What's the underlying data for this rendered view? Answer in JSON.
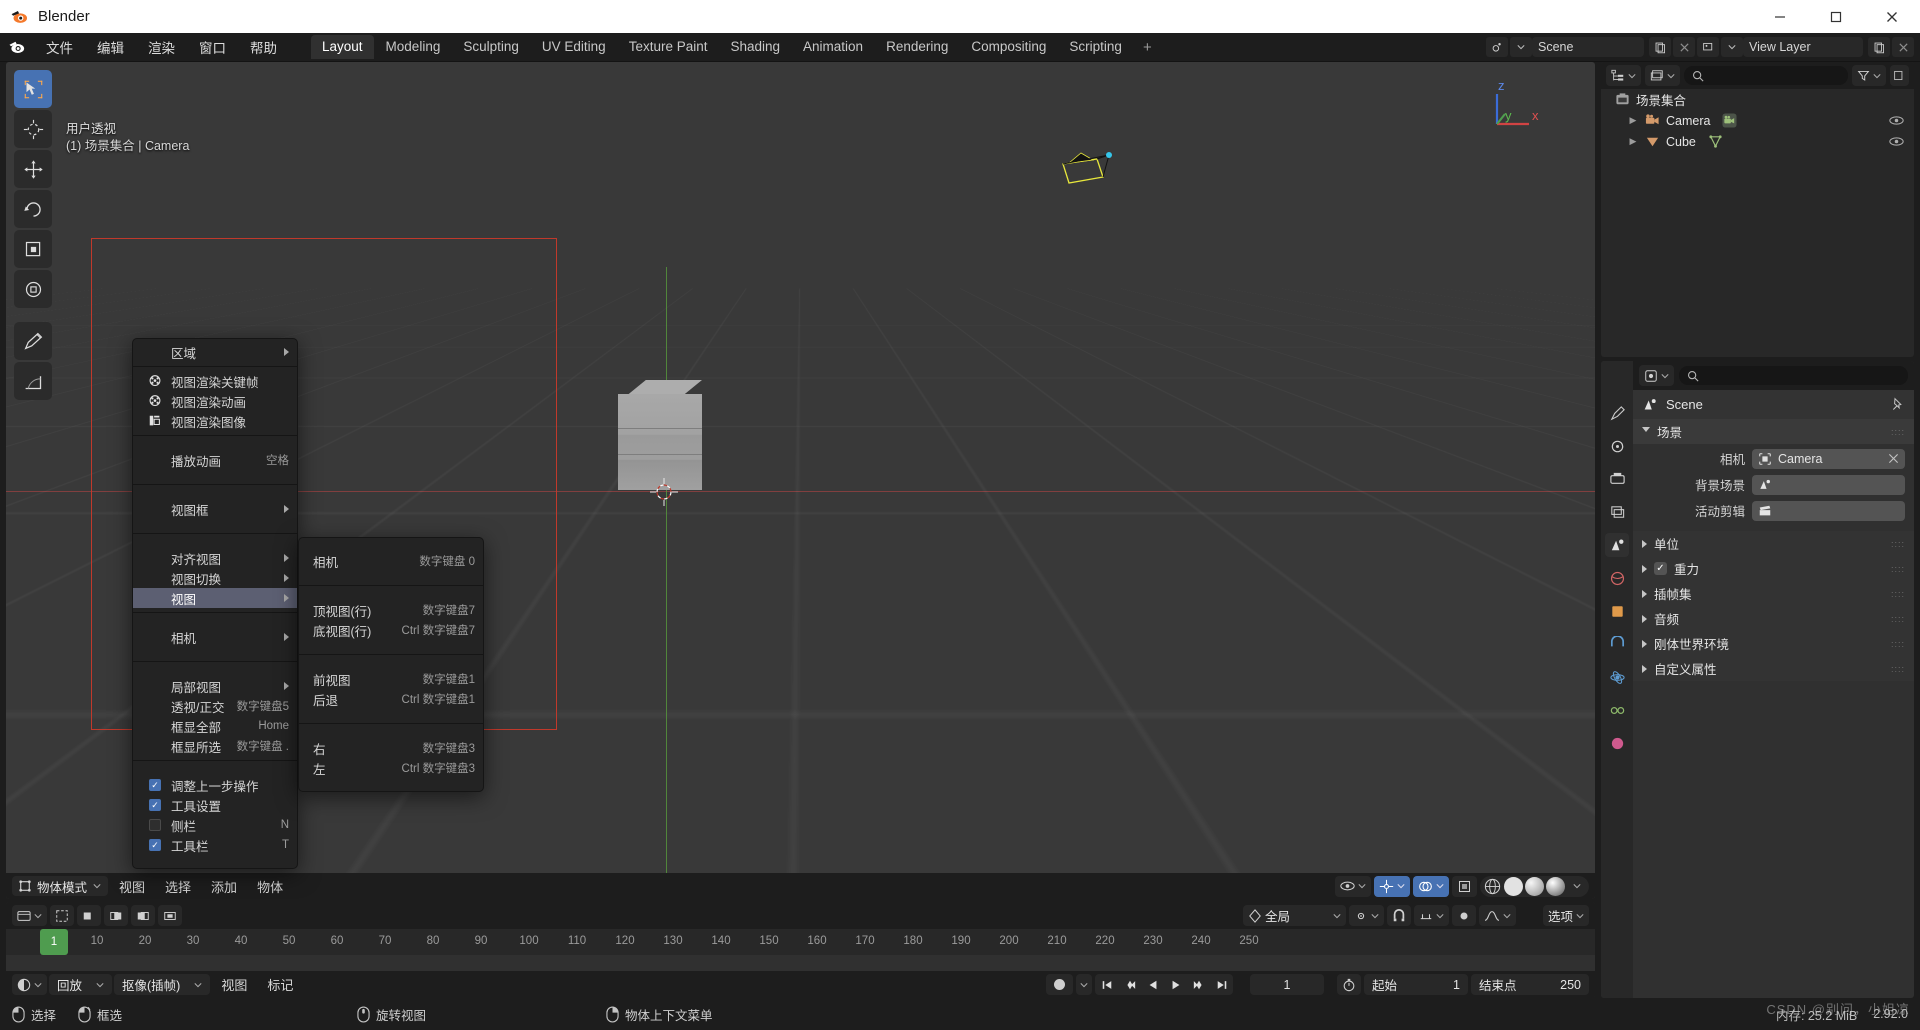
{
  "window": {
    "title": "Blender",
    "buttons": {
      "minimize": "─",
      "maximize": "☐",
      "close": "✕"
    }
  },
  "topbar": {
    "menus": [
      "文件",
      "编辑",
      "渲染",
      "窗口",
      "帮助"
    ],
    "workspaces": [
      "Layout",
      "Modeling",
      "Sculpting",
      "UV Editing",
      "Texture Paint",
      "Shading",
      "Animation",
      "Rendering",
      "Compositing",
      "Scripting"
    ],
    "add_workspace": "+",
    "scene_name": "Scene",
    "view_layer_name": "View Layer"
  },
  "viewport": {
    "overlay_line1": "用户透视",
    "overlay_line2": "(1) 场景集合 | Camera",
    "gizmo_axes": {
      "x": "x",
      "y": "y",
      "z": "z"
    },
    "footer": {
      "mode": "物体模式",
      "menus": [
        "视图",
        "选择",
        "添加",
        "物体"
      ]
    }
  },
  "toolbar": {
    "tools": [
      "tweak-select-tool",
      "cursor-tool",
      "move-tool",
      "rotate-tool",
      "scale-tool",
      "transform-tool",
      "annotate-tool",
      "measure-tool"
    ]
  },
  "context_menu": {
    "items": [
      {
        "type": "item",
        "label": "区域",
        "shortcut": "",
        "arrow": true,
        "icon": ""
      },
      {
        "type": "sep"
      },
      {
        "type": "item",
        "label": "视图渲染关键帧",
        "shortcut": "",
        "arrow": false,
        "icon": "film-icon"
      },
      {
        "type": "item",
        "label": "视图渲染动画",
        "shortcut": "",
        "arrow": false,
        "icon": "film-icon"
      },
      {
        "type": "item",
        "label": "视图渲染图像",
        "shortcut": "",
        "arrow": false,
        "icon": "render-image-icon"
      },
      {
        "type": "sep"
      },
      {
        "type": "item",
        "label": "播放动画",
        "shortcut": "空格",
        "arrow": false,
        "icon": ""
      },
      {
        "type": "sep"
      },
      {
        "type": "item",
        "label": "视图框",
        "shortcut": "",
        "arrow": true,
        "icon": ""
      },
      {
        "type": "sep"
      },
      {
        "type": "item",
        "label": "对齐视图",
        "shortcut": "",
        "arrow": true,
        "icon": ""
      },
      {
        "type": "item",
        "label": "视图切换",
        "shortcut": "",
        "arrow": true,
        "icon": ""
      },
      {
        "type": "item",
        "label": "视图",
        "shortcut": "",
        "arrow": true,
        "icon": "",
        "highlighted": true
      },
      {
        "type": "sep"
      },
      {
        "type": "item",
        "label": "相机",
        "shortcut": "",
        "arrow": true,
        "icon": ""
      },
      {
        "type": "sep"
      },
      {
        "type": "item",
        "label": "局部视图",
        "shortcut": "",
        "arrow": true,
        "icon": ""
      },
      {
        "type": "item",
        "label": "透视/正交",
        "shortcut": "数字键盘5",
        "arrow": false,
        "icon": ""
      },
      {
        "type": "item",
        "label": "框显全部",
        "shortcut": "Home",
        "arrow": false,
        "icon": ""
      },
      {
        "type": "item",
        "label": "框显所选",
        "shortcut": "数字键盘 .",
        "arrow": false,
        "icon": ""
      },
      {
        "type": "sep"
      },
      {
        "type": "check",
        "label": "调整上一步操作",
        "shortcut": "",
        "checked": true
      },
      {
        "type": "check",
        "label": "工具设置",
        "shortcut": "",
        "checked": true
      },
      {
        "type": "check",
        "label": "侧栏",
        "shortcut": "N",
        "checked": false
      },
      {
        "type": "check",
        "label": "工具栏",
        "shortcut": "T",
        "checked": true
      }
    ]
  },
  "submenu": {
    "items": [
      {
        "type": "item",
        "label": "相机",
        "shortcut": "数字键盘 0"
      },
      {
        "type": "sep"
      },
      {
        "type": "item",
        "label": "顶视图(行)",
        "shortcut": "数字键盘7"
      },
      {
        "type": "item",
        "label": "底视图(行)",
        "shortcut": "Ctrl 数字键盘7"
      },
      {
        "type": "sep"
      },
      {
        "type": "item",
        "label": "前视图",
        "shortcut": "数字键盘1"
      },
      {
        "type": "item",
        "label": "后退",
        "shortcut": "Ctrl 数字键盘1"
      },
      {
        "type": "sep"
      },
      {
        "type": "item",
        "label": "右",
        "shortcut": "数字键盘3"
      },
      {
        "type": "item",
        "label": "左",
        "shortcut": "Ctrl 数字键盘3"
      }
    ]
  },
  "outliner": {
    "search_placeholder": "",
    "root": "场景集合",
    "rows": [
      {
        "label": "Camera",
        "icon": "camera-icon",
        "data_icon": "camera-data-icon"
      },
      {
        "label": "Cube",
        "icon": "mesh-object-icon",
        "data_icon": "mesh-data-icon"
      }
    ]
  },
  "properties": {
    "breadcrumb": "Scene",
    "search_placeholder": "",
    "panels": [
      {
        "label": "场景",
        "open": true
      },
      {
        "label": "单位",
        "open": false
      },
      {
        "label": "重力",
        "open": false,
        "checkbox": true
      },
      {
        "label": "插帧集",
        "open": false
      },
      {
        "label": "音频",
        "open": false
      },
      {
        "label": "刚体世界环境",
        "open": false
      },
      {
        "label": "自定义属性",
        "open": false
      }
    ],
    "fields": [
      {
        "label": "相机",
        "value": "Camera",
        "icon": "camera-field-icon",
        "clearable": true
      },
      {
        "label": "背景场景",
        "value": "",
        "icon": "scene-field-icon",
        "clearable": false
      },
      {
        "label": "活动剪辑",
        "value": "",
        "icon": "clip-field-icon",
        "clearable": false
      }
    ]
  },
  "timeline": {
    "header_menus": [
      "回放",
      "抠像(插帧)",
      "视图",
      "标记"
    ],
    "ticks": [
      "10",
      "20",
      "30",
      "40",
      "50",
      "60",
      "70",
      "80",
      "90",
      "100",
      "110",
      "120",
      "130",
      "140",
      "150",
      "160",
      "170",
      "180",
      "190",
      "200",
      "210",
      "220",
      "230",
      "240",
      "250"
    ],
    "current_frame": "1",
    "frame_field": "1",
    "start_label": "起始",
    "start_value": "1",
    "end_label": "结束点",
    "end_value": "250"
  },
  "statusbar": {
    "items": [
      {
        "icon": "mouse-left-icon",
        "label": "选择"
      },
      {
        "icon": "mouse-drag-icon",
        "label": "框选"
      },
      {
        "icon": "mouse-middle-icon",
        "label": "旋转视图"
      },
      {
        "icon": "mouse-right-icon",
        "label": "物体上下文菜单"
      }
    ],
    "memory": "内存: 25.2 MiB",
    "version": "2.92.0",
    "watermark": "CSDN @别问，小姐凉"
  },
  "colors": {
    "accent": "#4772b3",
    "highlight": "#5c5f72",
    "green": "#4f9c4f",
    "camera_frame": "#c0392b",
    "axis_x": "#bd4646",
    "axis_y": "#5aa03c",
    "orange": "#e87d0d"
  }
}
